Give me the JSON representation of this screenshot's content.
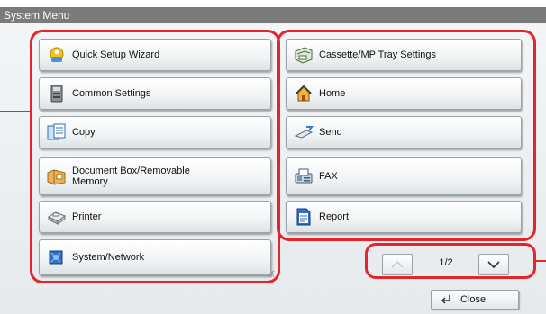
{
  "window": {
    "title": "System Menu"
  },
  "left_buttons": [
    {
      "label": "Quick Setup Wizard",
      "icon": "wizard-icon"
    },
    {
      "label": "Common Settings",
      "icon": "settings-device-icon"
    },
    {
      "label": "Copy",
      "icon": "copy-icon"
    },
    {
      "label": "Document Box/Removable Memory",
      "icon": "document-box-icon"
    },
    {
      "label": "Printer",
      "icon": "printer-icon"
    },
    {
      "label": "System/Network",
      "icon": "network-icon"
    }
  ],
  "right_buttons": [
    {
      "label": "Cassette/MP Tray Settings",
      "icon": "tray-icon"
    },
    {
      "label": "Home",
      "icon": "home-icon"
    },
    {
      "label": "Send",
      "icon": "send-icon"
    },
    {
      "label": "FAX",
      "icon": "fax-icon"
    },
    {
      "label": "Report",
      "icon": "report-icon"
    }
  ],
  "pager": {
    "page_text": "1/2"
  },
  "close": {
    "label": "Close",
    "icon": "enter-arrow-icon"
  },
  "colors": {
    "highlight": "#e3262e",
    "titlebar": "#7b7b7b"
  }
}
